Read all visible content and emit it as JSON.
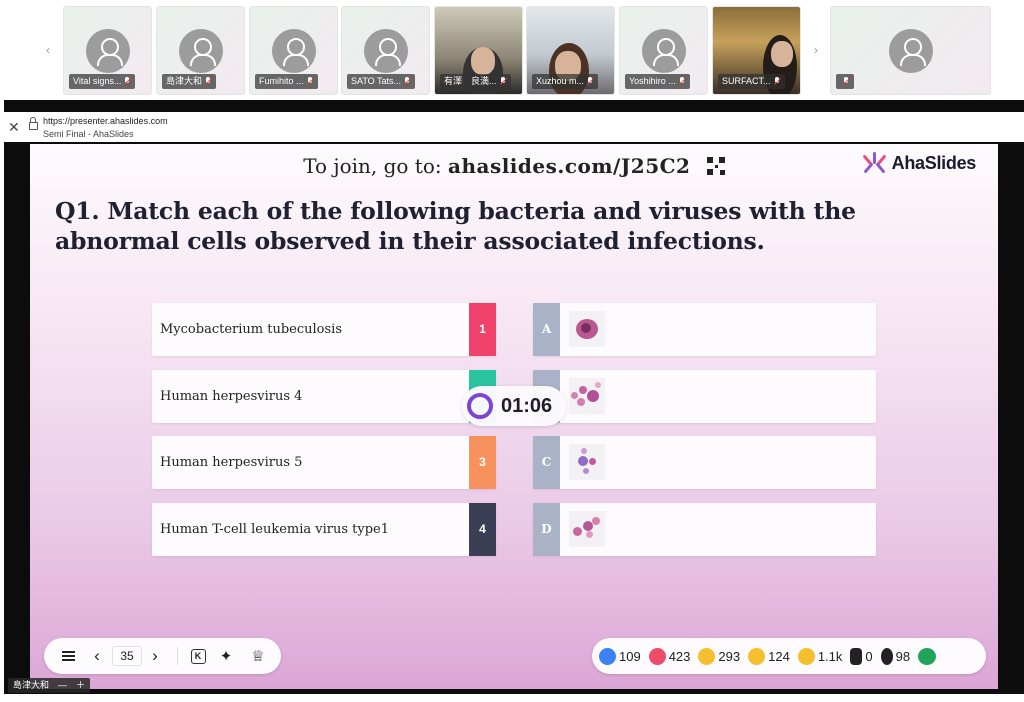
{
  "participants": [
    {
      "name": "Vital signs...",
      "type": "avatar"
    },
    {
      "name": "島津大和",
      "type": "avatar"
    },
    {
      "name": "Fumihito ...",
      "type": "avatar"
    },
    {
      "name": "SATO Tats...",
      "type": "avatar"
    },
    {
      "name": "有澤　良満...",
      "type": "video"
    },
    {
      "name": "Xuzhou m...",
      "type": "video"
    },
    {
      "name": "Yoshihiro ...",
      "type": "avatar"
    },
    {
      "name": "SURFACT...",
      "type": "video"
    },
    {
      "name": "",
      "type": "avatar"
    }
  ],
  "browser": {
    "url": "https://presenter.ahaslides.com",
    "page_title": "Semi Final - AhaSlides"
  },
  "slide": {
    "join_prefix": "To join, go to:",
    "join_code": "ahaslides.com/J25C2",
    "brand": "AhaSlides",
    "question": "Q1. Match each of the following bacteria and viruses with the abnormal cells observed in their associated infections.",
    "left_items": [
      {
        "text": "Mycobacterium tubeculosis",
        "num": "1",
        "color": "#f0416a"
      },
      {
        "text": "Human herpesvirus 4",
        "num": "2",
        "color": "#2bc4a0"
      },
      {
        "text": "Human herpesvirus 5",
        "num": "3",
        "color": "#f7925e"
      },
      {
        "text": "Human T-cell leukemia virus type1",
        "num": "4",
        "color": "#3a3f55"
      }
    ],
    "right_items": [
      {
        "letter": "A",
        "image": "giant-cell-image"
      },
      {
        "letter": "B",
        "image": "atypical-lymphocyte-image"
      },
      {
        "letter": "C",
        "image": "owl-eye-cell-image"
      },
      {
        "letter": "D",
        "image": "flower-cell-image"
      }
    ],
    "timer": "01:06"
  },
  "controls": {
    "slide_number": "35"
  },
  "reactions": [
    {
      "icon": "like-icon",
      "value": "109",
      "color": "#3b82f6"
    },
    {
      "icon": "heart-icon",
      "value": "423",
      "color": "#ef4b6b"
    },
    {
      "icon": "laugh-icon",
      "value": "293",
      "color": "#f5c02e"
    },
    {
      "icon": "wow-icon",
      "value": "124",
      "color": "#f5c02e"
    },
    {
      "icon": "sad-icon",
      "value": "1.1k",
      "color": "#f5c02e"
    },
    {
      "icon": "raise-hand-icon",
      "value": "0",
      "color": "#222222"
    },
    {
      "icon": "participants-icon",
      "value": "98",
      "color": "#222222"
    }
  ],
  "bottom_label": "島津大和　—　＋"
}
